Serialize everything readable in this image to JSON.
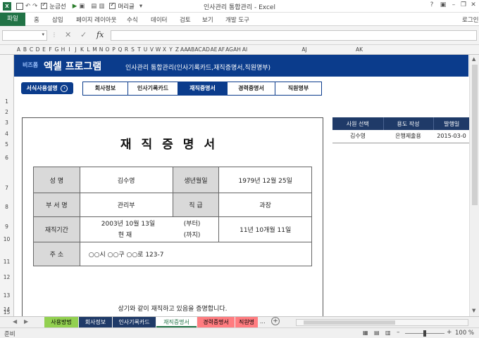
{
  "window": {
    "title": "인사관리 통합관리 - Excel",
    "user": "로그인",
    "quick_access": {
      "gridlines": "눈금선",
      "ruler": "머리글"
    }
  },
  "ribbon": {
    "file_tab": "파일",
    "tabs": [
      "홈",
      "삽입",
      "페이지 레이아웃",
      "수식",
      "데이터",
      "검토",
      "보기",
      "개발 도구"
    ]
  },
  "formula_bar": {
    "name_box": "",
    "fx": "fx",
    "value": ""
  },
  "columns": [
    "A",
    "B",
    "C",
    "D",
    "E",
    "F",
    "G",
    "H",
    "I",
    "J",
    "K",
    "L",
    "M",
    "N",
    "O",
    "P",
    "Q",
    "R",
    "S",
    "T",
    "U",
    "V",
    "W",
    "X",
    "Y",
    "Z",
    "AA",
    "AB",
    "AC",
    "AD",
    "AE",
    "AF",
    "AG",
    "AH",
    "AI",
    "AJ",
    "AK"
  ],
  "rows": [
    "1",
    "2",
    "3",
    "4",
    "5",
    "6",
    "7",
    "8",
    "9",
    "10",
    "11",
    "12",
    "13",
    "14",
    "15"
  ],
  "banner": {
    "logo": "비즈폼",
    "title": "엑셀 프로그램",
    "subtitle": "인사관리 통합관리(인사기록카드,재직증명서,직원명부)"
  },
  "nav": {
    "guide_button": "서식사용설명",
    "tabs": [
      "회사정보",
      "인사기록카드",
      "재직증명서",
      "경력증명서",
      "직원명부"
    ],
    "active_tab": "재직증명서"
  },
  "certificate": {
    "title": "재직증명서",
    "name_label": "성    명",
    "name_value": "김수영",
    "birth_label": "생년월일",
    "birth_value": "1979년 12월 25일",
    "dept_label": "부 서 명",
    "dept_value": "관리부",
    "position_label": "직    급",
    "position_value": "과장",
    "period_label": "재직기간",
    "period_start": "2003년 10월 13일",
    "period_start_suffix": "(부터)",
    "period_end": "현    재",
    "period_end_suffix": "(까지)",
    "period_total": "11년 10개월 11일",
    "address_label": "주    소",
    "address_value": "○○시 ○○구 ○○로 123-7",
    "statement": "상기와 같이 재직하고 있음을 증명합니다."
  },
  "side_table": {
    "headers": [
      "사원 선택",
      "용도 작성",
      "발행일"
    ],
    "rows": [
      [
        "김수영",
        "은행제출용",
        "2015-03-0"
      ]
    ]
  },
  "sheet_tabs": [
    {
      "label": "사용방법",
      "color": "#92d050",
      "text": "#000000"
    },
    {
      "label": "회사정보",
      "color": "#1f3a68",
      "text": "#ffffff"
    },
    {
      "label": "인사기록카드",
      "color": "#1f3a68",
      "text": "#ffffff"
    },
    {
      "label": "재직증명서",
      "color": "#ffffff",
      "text": "#217346"
    },
    {
      "label": "경력증명서",
      "color": "#ff7c80",
      "text": "#000000"
    },
    {
      "label": "직원명",
      "color": "#ff7c80",
      "text": "#000000"
    }
  ],
  "sheet_more": "...",
  "status": {
    "left": "준비",
    "zoom": "100 %"
  }
}
